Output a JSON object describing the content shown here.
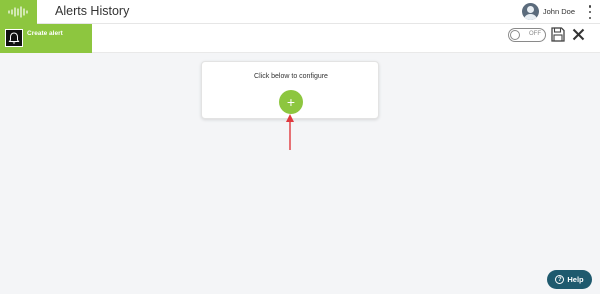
{
  "header": {
    "app_title": "Alerts History",
    "user_name": "John Doe",
    "brand_color": "#8dc63f",
    "logo_icon": "waveform-logo-icon",
    "menu_icon": "kebab-menu-icon"
  },
  "toolbar": {
    "create_label": "Create alert",
    "create_icon": "alert-bell-icon",
    "toggle_label": "OFF",
    "toggle_state": "off",
    "save_icon": "save-icon",
    "close_icon": "close-icon"
  },
  "main": {
    "card_title": "Click below to configure",
    "add_label": "+",
    "arrow_color": "#e0393e"
  },
  "help": {
    "label": "Help",
    "icon_glyph": "?",
    "color": "#1f5a6e"
  }
}
